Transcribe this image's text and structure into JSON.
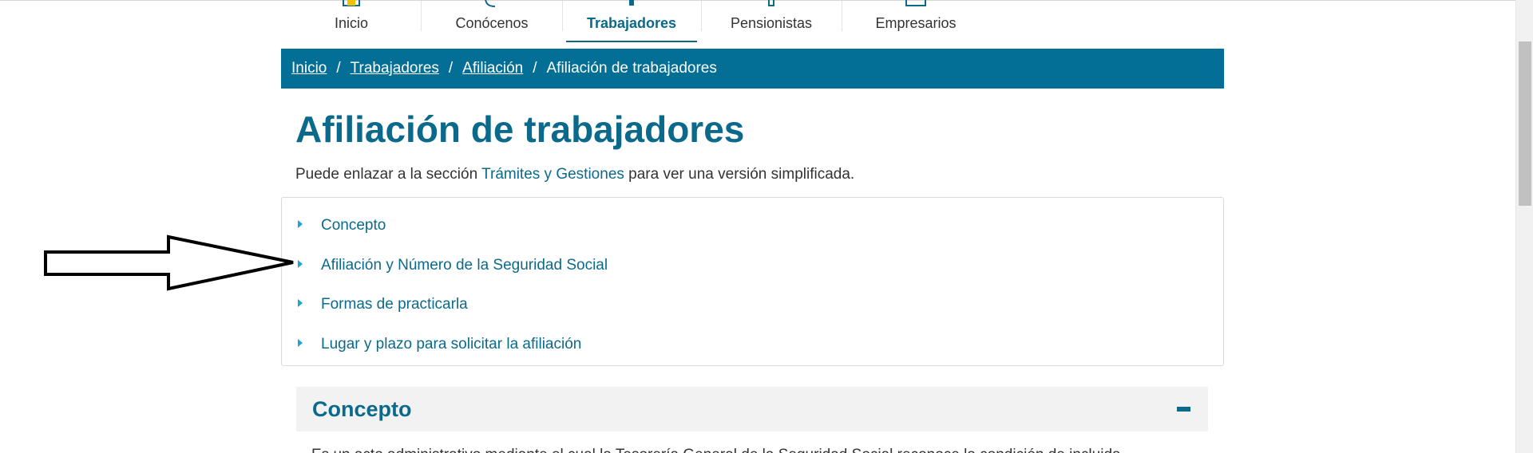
{
  "topnav": {
    "items": [
      {
        "label": "Inicio"
      },
      {
        "label": "Conócenos"
      },
      {
        "label": "Trabajadores",
        "active": true
      },
      {
        "label": "Pensionistas"
      },
      {
        "label": "Empresarios"
      }
    ]
  },
  "breadcrumb": {
    "items": [
      "Inicio",
      "Trabajadores",
      "Afiliación"
    ],
    "current": "Afiliación de trabajadores",
    "separator": "/"
  },
  "page": {
    "title": "Afiliación de trabajadores",
    "intro_before": "Puede enlazar a la sección ",
    "intro_link": "Trámites y Gestiones",
    "intro_after": " para ver una versión simplificada."
  },
  "index": {
    "items": [
      "Concepto",
      "Afiliación y Número de la Seguridad Social",
      "Formas de practicarla",
      "Lugar y plazo para solicitar la afiliación"
    ]
  },
  "section": {
    "title": "Concepto",
    "body_partial": "Es un acto administrativo mediante el cual la Tesorería General de la Seguridad Social reconoce la condición de incluida"
  },
  "colors": {
    "brand": "#036f96",
    "heading": "#0b6a8b",
    "bullet": "#1aa6d6",
    "section_bg": "#f2f2f2"
  }
}
